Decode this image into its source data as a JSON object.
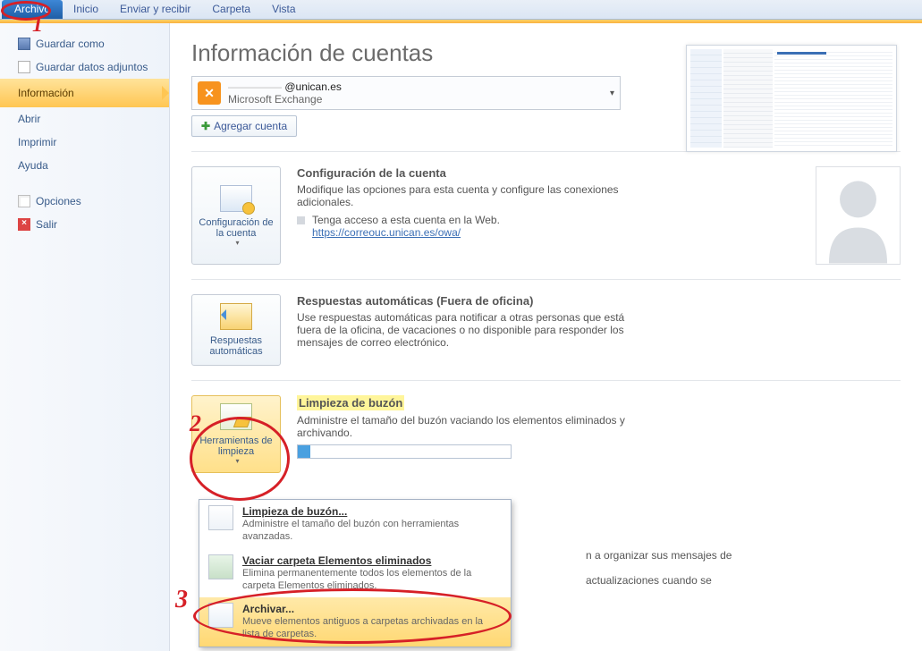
{
  "ribbon": {
    "file": "Archivo",
    "tabs": [
      "Inicio",
      "Enviar y recibir",
      "Carpeta",
      "Vista"
    ]
  },
  "nav": {
    "save_as": "Guardar como",
    "save_attach": "Guardar datos adjuntos",
    "info": "Información",
    "open": "Abrir",
    "print": "Imprimir",
    "help": "Ayuda",
    "options": "Opciones",
    "exit": "Salir"
  },
  "title": "Información de cuentas",
  "account": {
    "email_suffix": "@unican.es",
    "type": "Microsoft Exchange"
  },
  "add_account": "Agregar cuenta",
  "cfg": {
    "btn": "Configuración de la cuenta",
    "h": "Configuración de la cuenta",
    "p1": "Modifique las opciones para esta cuenta y configure las conexiones adicionales.",
    "p2": "Tenga acceso a esta cuenta en la Web.",
    "link": "https://correouc.unican.es/owa/"
  },
  "auto": {
    "btn": "Respuestas automáticas",
    "h": "Respuestas automáticas (Fuera de oficina)",
    "p": "Use respuestas automáticas para notificar a otras personas que está fuera de la oficina, de vacaciones o no disponible para responder los mensajes de correo electrónico."
  },
  "clean": {
    "btn": "Herramientas de limpieza",
    "h": "Limpieza de buzón",
    "p": "Administre el tamaño del buzón vaciando los elementos eliminados y archivando."
  },
  "trail": {
    "p1": "n a organizar sus mensajes de",
    "p2": "actualizaciones cuando se"
  },
  "menu": {
    "i1t": "Limpieza de buzón...",
    "i1d": "Administre el tamaño del buzón con herramientas avanzadas.",
    "i2t": "Vaciar carpeta Elementos eliminados",
    "i2d": "Elimina permanentemente todos los elementos de la carpeta Elementos eliminados.",
    "i3t": "Archivar...",
    "i3d": "Mueve elementos antiguos a carpetas archivadas en la lista de carpetas."
  },
  "anno": {
    "n1": "1",
    "n2": "2",
    "n3": "3"
  }
}
